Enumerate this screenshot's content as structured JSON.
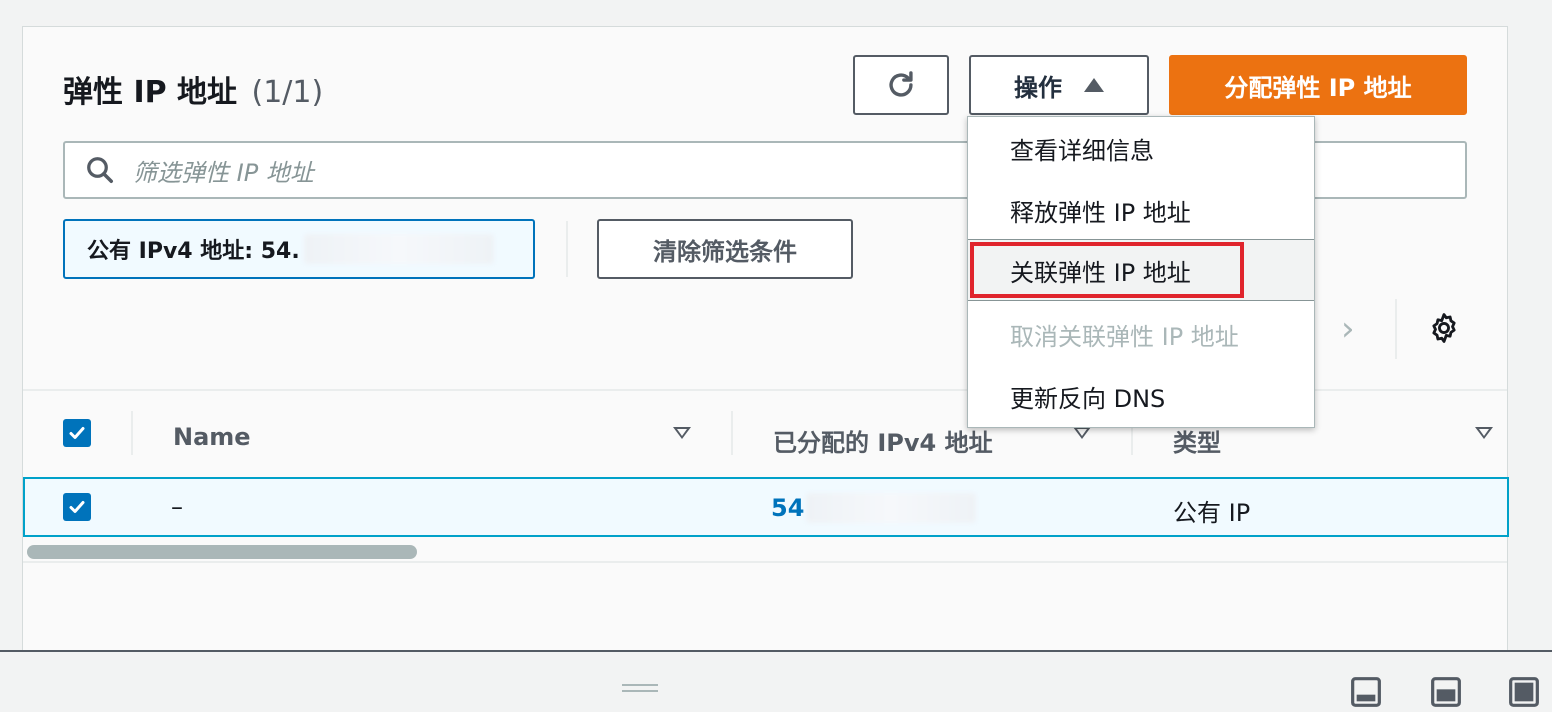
{
  "header": {
    "title": "弹性 IP 地址",
    "count": "(1/1)",
    "actions_label": "操作",
    "allocate_label": "分配弹性 IP 地址"
  },
  "search": {
    "placeholder": "筛选弹性 IP 地址"
  },
  "filter": {
    "token_label": "公有 IPv4 地址: 54.",
    "clear_label": "清除筛选条件"
  },
  "table": {
    "columns": [
      "Name",
      "已分配的 IPv4 地址",
      "类型"
    ],
    "rows": [
      {
        "name": "–",
        "ipv4": "54",
        "type": "公有 IP",
        "selected": true
      }
    ]
  },
  "actions_menu": {
    "items": [
      {
        "label": "查看详细信息",
        "disabled": false
      },
      {
        "label": "释放弹性 IP 地址",
        "disabled": false
      },
      {
        "label": "关联弹性 IP 地址",
        "disabled": false,
        "highlighted": true
      },
      {
        "label": "取消关联弹性 IP 地址",
        "disabled": true
      },
      {
        "label": "更新反向 DNS",
        "disabled": false
      }
    ]
  },
  "colors": {
    "primary_button": "#ec7211",
    "link": "#0073bb",
    "selection_border": "#00a1c9",
    "highlight_box": "#e0242c"
  },
  "icons": {
    "refresh": "refresh-icon",
    "search": "search-icon",
    "settings": "gear-icon",
    "next_page": "chevron-right-icon"
  }
}
